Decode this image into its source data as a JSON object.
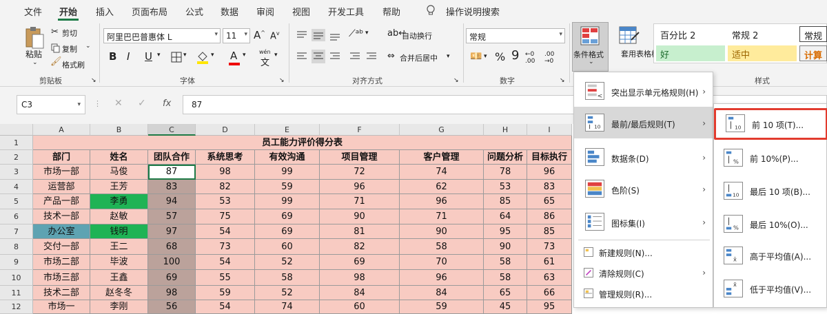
{
  "tabs": [
    "文件",
    "开始",
    "插入",
    "页面布局",
    "公式",
    "数据",
    "审阅",
    "视图",
    "开发工具",
    "帮助",
    "操作说明搜索"
  ],
  "ribbon": {
    "clipboard": {
      "paste": "粘贴",
      "cut": "剪切",
      "copy": "复制",
      "format_painter": "格式刷",
      "group": "剪贴板"
    },
    "font": {
      "name": "阿里巴巴普惠体 L",
      "size": "11",
      "grow": "A",
      "shrink": "A",
      "bold": "B",
      "italic": "I",
      "underline": "U",
      "font_color": "A",
      "wen": "wén",
      "group": "字体"
    },
    "align": {
      "wrap": "自动换行",
      "merge": "合并后居中",
      "group": "对齐方式"
    },
    "number": {
      "format": "常规",
      "group": "数字"
    },
    "cond_format": {
      "label": "条件格式",
      "table_format": "套用表格格式"
    },
    "styles": {
      "cells": [
        "百分比 2",
        "常规 2",
        "常规",
        "好",
        "适中",
        "计算"
      ],
      "group": "样式"
    }
  },
  "formula": {
    "namebox": "C3",
    "fx": "fx",
    "value": "87"
  },
  "sheet": {
    "col_headers": [
      "A",
      "B",
      "C",
      "D",
      "E",
      "F",
      "G",
      "H",
      "I"
    ],
    "row_numbers": [
      "1",
      "2",
      "3",
      "4",
      "5",
      "6",
      "7",
      "8",
      "9",
      "10",
      "11",
      "12"
    ],
    "title": "员工能力评价得分表",
    "headers": [
      "部门",
      "姓名",
      "团队合作",
      "系统思考",
      "有效沟通",
      "项目管理",
      "客户管理",
      "问题分析",
      "目标执行"
    ],
    "rows": [
      [
        "市场一部",
        "马俊",
        "87",
        "98",
        "99",
        "72",
        "74",
        "78",
        "96"
      ],
      [
        "运营部",
        "王芳",
        "83",
        "82",
        "59",
        "96",
        "62",
        "53",
        "83"
      ],
      [
        "产品一部",
        "李勇",
        "94",
        "53",
        "99",
        "71",
        "96",
        "85",
        "65"
      ],
      [
        "技术一部",
        "赵敏",
        "57",
        "75",
        "69",
        "90",
        "71",
        "64",
        "86"
      ],
      [
        "办公室",
        "钱明",
        "97",
        "54",
        "69",
        "81",
        "90",
        "95",
        "85"
      ],
      [
        "交付一部",
        "王二",
        "68",
        "73",
        "60",
        "82",
        "58",
        "90",
        "73"
      ],
      [
        "市场二部",
        "毕波",
        "100",
        "54",
        "52",
        "69",
        "70",
        "58",
        "61"
      ],
      [
        "市场三部",
        "王鑫",
        "69",
        "55",
        "58",
        "98",
        "96",
        "58",
        "63"
      ],
      [
        "技术二部",
        "赵冬冬",
        "98",
        "59",
        "52",
        "84",
        "84",
        "65",
        "66"
      ],
      [
        "市场一",
        "李刚",
        "56",
        "54",
        "74",
        "60",
        "59",
        "45",
        "95"
      ]
    ]
  },
  "menu": {
    "items": [
      "突出显示单元格规则(H)",
      "最前/最后规则(T)",
      "数据条(D)",
      "色阶(S)",
      "图标集(I)",
      "新建规则(N)...",
      "清除规则(C)",
      "管理规则(R)..."
    ]
  },
  "submenu": {
    "items": [
      "前 10 项(T)...",
      "前 10%(P)...",
      "最后 10 项(B)...",
      "最后 10%(O)...",
      "高于平均值(A)...",
      "低于平均值(V)..."
    ]
  },
  "colors": {
    "accent": "#1d7a46",
    "pink": "#f8cbc2",
    "green": "#1fb355",
    "teal": "#5ea3b2",
    "mauve": "#bba29b",
    "highlight": "#e23b2e"
  }
}
